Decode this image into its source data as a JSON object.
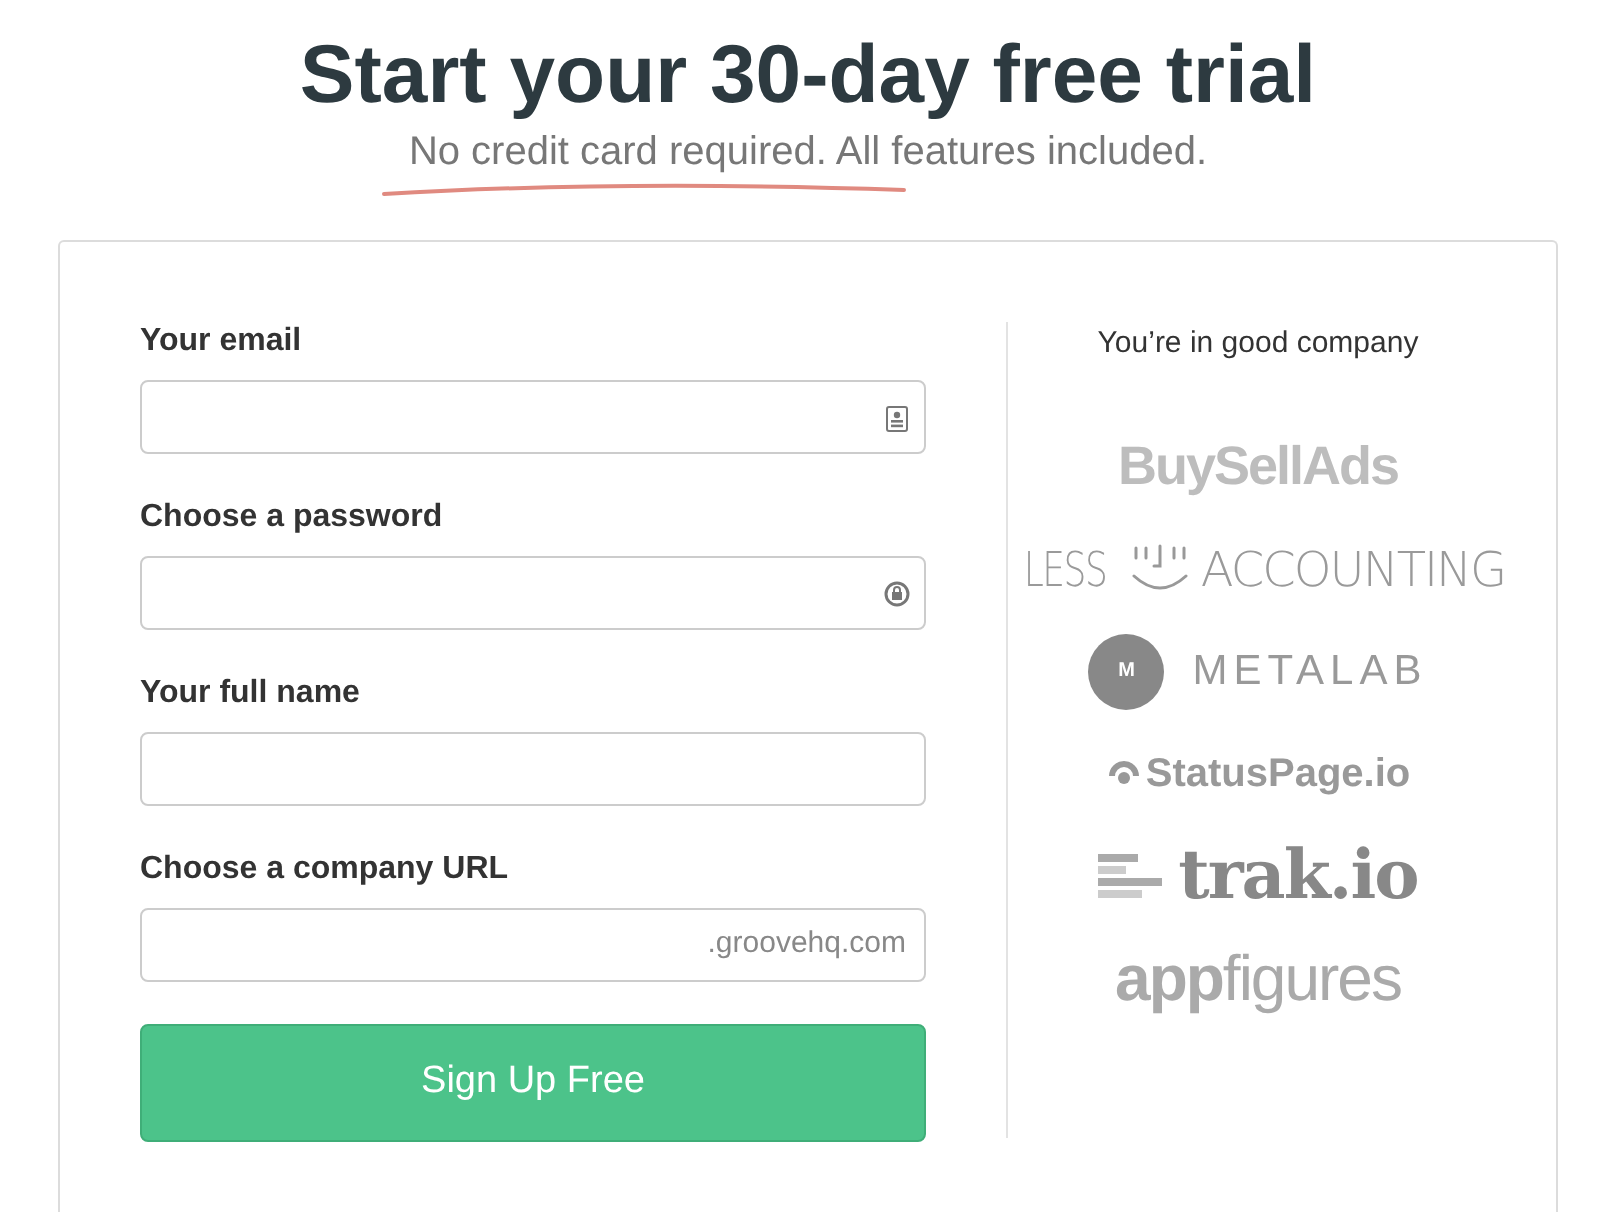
{
  "heading": {
    "title": "Start your 30-day free trial",
    "subtitle": "No credit card required. All features included."
  },
  "form": {
    "fields": [
      {
        "label": "Your email",
        "kind": "email"
      },
      {
        "label": "Choose a password",
        "kind": "password"
      },
      {
        "label": "Your full name",
        "kind": "text"
      },
      {
        "label": "Choose a company URL",
        "kind": "url",
        "suffix": ".groovehq.com"
      }
    ],
    "submit": "Sign Up Free"
  },
  "customers": {
    "title": "You’re in good company",
    "logos": [
      {
        "kind": "buysellads",
        "text": "BuySellAds"
      },
      {
        "kind": "lessaccounting",
        "left": "LESS",
        "right": "ACCOUNTING"
      },
      {
        "kind": "metalab",
        "mark": "M",
        "text": "METALAB"
      },
      {
        "kind": "statuspage",
        "text": "StatusPage.io"
      },
      {
        "kind": "trak",
        "text": "trak.io"
      },
      {
        "kind": "appfigures",
        "bold": "app",
        "light": "figures"
      }
    ]
  }
}
